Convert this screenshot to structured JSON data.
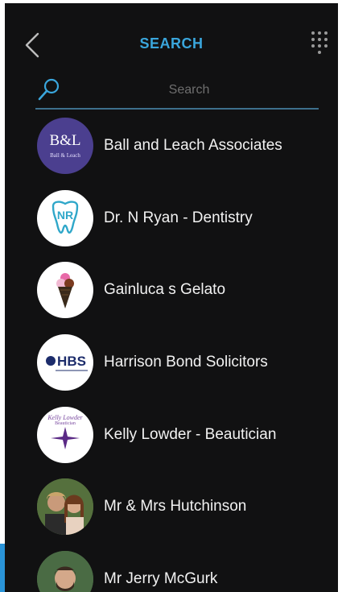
{
  "header": {
    "title": "SEARCH",
    "back_icon": "chevron-left-icon",
    "menu_icon": "grid-dots-icon"
  },
  "search": {
    "placeholder": "Search",
    "value": "",
    "icon": "search-icon"
  },
  "results": [
    {
      "name": "Ball and Leach Associates",
      "logo_text": "B&L",
      "logo_subtext": "Ball & Leach"
    },
    {
      "name": "Dr. N Ryan - Dentistry",
      "logo_text": "NR"
    },
    {
      "name": "Gainluca s Gelato"
    },
    {
      "name": "Harrison Bond Solicitors",
      "logo_text": "HBS"
    },
    {
      "name": "Kelly Lowder - Beautician",
      "logo_text": "Kelly Lowder",
      "logo_subtext": "Beautician"
    },
    {
      "name": "Mr & Mrs Hutchinson"
    },
    {
      "name": "Mr Jerry McGurk"
    }
  ],
  "colors": {
    "background": "#111112",
    "accent": "#3aa6dc",
    "text": "#f2f2f2",
    "placeholder": "#6e6e6e"
  }
}
